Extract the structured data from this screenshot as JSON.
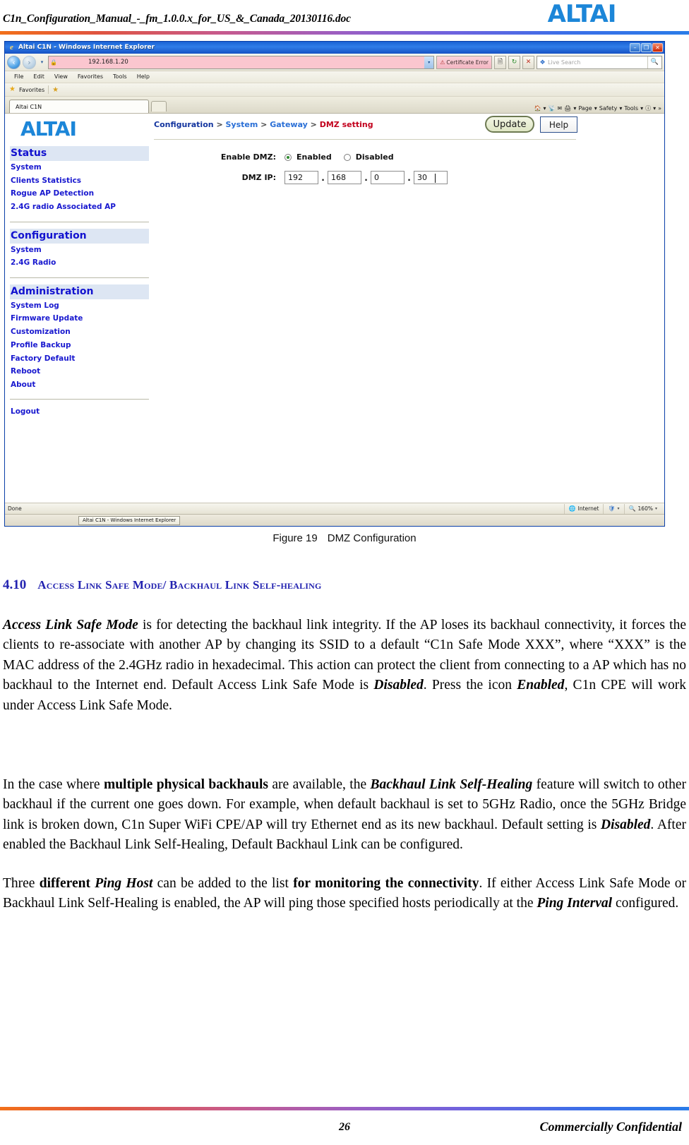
{
  "document": {
    "header_filename": "C1n_Configuration_Manual_-_fm_1.0.0.x_for_US_&_Canada_20130116.doc",
    "brand": "ALTAI",
    "footer_page_number": "26",
    "footer_confidentiality": "Commercially Confidential"
  },
  "browser": {
    "title": "Altai C1N - Windows Internet Explorer",
    "window_buttons": {
      "minimize": "–",
      "maximize": "❐",
      "close": "✕"
    },
    "nav": {
      "back_icon": "back-arrow-icon",
      "forward_icon": "forward-arrow-icon",
      "history_caret": "▾",
      "address_value": "192.168.1.20",
      "address_dropdown": "▾",
      "certificate_error": "Certificate Error",
      "compat_button": "compatibility-view-icon",
      "refresh_button": "refresh-icon",
      "stop_button": "✕",
      "search_placeholder": "Live Search",
      "search_go": "search-icon"
    },
    "menu": [
      "File",
      "Edit",
      "View",
      "Favorites",
      "Tools",
      "Help"
    ],
    "favorites_bar": {
      "label": "Favorites",
      "add_icon": "add-favorite-icon"
    },
    "tabs": [
      {
        "label": "Altai C1N"
      }
    ],
    "command_bar": [
      "Page",
      "Safety",
      "Tools"
    ],
    "status_bar": {
      "message": "Done",
      "zone": "Internet",
      "zoom": "160%"
    },
    "taskbar": {
      "button": "Altai C1N - Windows Internet Explorer"
    }
  },
  "web_ui": {
    "breadcrumb": {
      "level1": "Configuration",
      "sep1": ">",
      "level2": "System",
      "sep2": ">",
      "level3": "Gateway",
      "sep3": ">",
      "current": "DMZ setting"
    },
    "buttons": {
      "update": "Update",
      "help": "Help"
    },
    "sidebar": {
      "groups": [
        {
          "heading": "Status",
          "items": [
            "System",
            "Clients Statistics",
            "Rogue AP Detection",
            "2.4G radio Associated AP"
          ]
        },
        {
          "heading": "Configuration",
          "items": [
            "System",
            "2.4G Radio"
          ]
        },
        {
          "heading": "Administration",
          "items": [
            "System Log",
            "Firmware Update",
            "Customization",
            "Profile Backup",
            "Factory Default",
            "Reboot",
            "About"
          ]
        }
      ],
      "logout": "Logout"
    },
    "form": {
      "enable_dmz_label": "Enable DMZ:",
      "enabled_label": "Enabled",
      "disabled_label": "Disabled",
      "enable_dmz_value": "Enabled",
      "dmz_ip_label": "DMZ IP:",
      "dmz_ip_octets": [
        "192",
        "168",
        "0",
        "30"
      ],
      "dot": "."
    }
  },
  "figure": {
    "label": "Figure 19",
    "caption": "DMZ Configuration"
  },
  "section": {
    "number": "4.10",
    "title": "Access Link Safe Mode/ Backhaul Link Self-healing"
  },
  "paragraphs": {
    "p1": {
      "t1": "Access Link Safe Mode",
      "t2": " is for detecting the backhaul link integrity. If the AP loses its backhaul connectivity, it forces the clients to re-associate with another AP by changing its SSID to a default “C1n Safe Mode XXX”, where “XXX” is the MAC address of the 2.4GHz radio in hexadecimal. This action can protect the client from connecting to a AP which has no backhaul to the Internet end. Default Access Link Safe Mode is ",
      "t3": "Disabled",
      "t4": ". Press the icon ",
      "t5": "Enabled",
      "t6": ", C1n CPE will work under Access Link Safe Mode."
    },
    "p2": {
      "t1": "In the case where ",
      "t2": "multiple physical backhauls",
      "t3": " are available, the ",
      "t4": "Backhaul Link Self-Healing",
      "t5": " feature will switch to other backhaul if the current one goes down. For example, when default backhaul is set to 5GHz Radio, once the 5GHz Bridge link is broken down, C1n Super WiFi CPE/AP will try Ethernet end as its new backhaul. Default setting is ",
      "t6": "Disabled",
      "t7": ". After enabled the Backhaul Link Self-Healing, Default Backhaul Link can be configured."
    },
    "p3": {
      "t1": "Three ",
      "t2": "different ",
      "t3": "Ping Host",
      "t4": " can be added to the list ",
      "t5": "for monitoring the connectivity",
      "t6": ". If either Access Link Safe Mode or Backhaul Link Self-Healing is enabled, the AP will ping those specified hosts periodically at the ",
      "t7": "Ping Interval",
      "t8": " configured."
    }
  }
}
